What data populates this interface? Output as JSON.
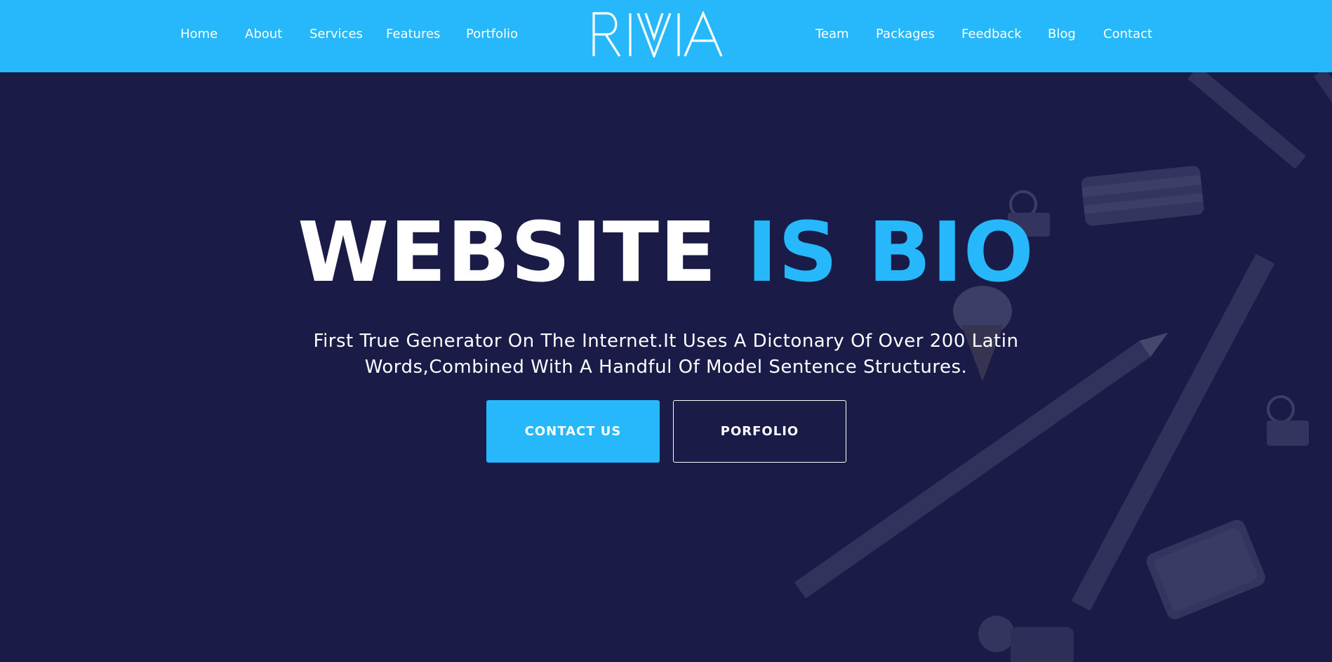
{
  "header": {
    "nav_left": [
      "Home",
      "About",
      "Services",
      "Features",
      "Portfolio"
    ],
    "logo": "RIVIA",
    "nav_right": [
      "Team",
      "Packages",
      "Feedback",
      "Blog",
      "Contact"
    ]
  },
  "hero": {
    "headline_white": "WEBSITE",
    "headline_accent": "IS BIO",
    "subtext_line1": "First True Generator On The Internet.It Uses A Dictonary Of Over 200 Latin",
    "subtext_line2": "Words,Combined With A Handful Of Model Sentence Structures.",
    "primary_button": "CONTACT US",
    "secondary_button": "PORFOLIO"
  },
  "colors": {
    "accent": "#27b8fc",
    "background": "#1a1b46",
    "text": "#ffffff"
  }
}
